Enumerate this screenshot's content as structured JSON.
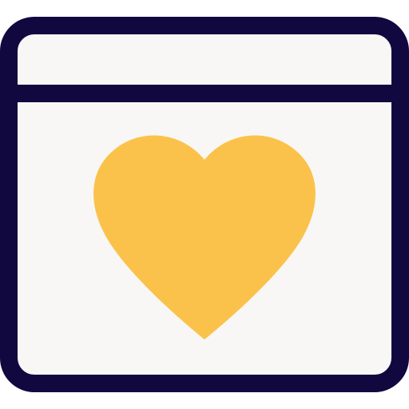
{
  "icon": {
    "name": "browser-window-heart-icon",
    "colors": {
      "background": "#ffffff",
      "window_fill": "#f8f7f6",
      "outline": "#110840",
      "heart": "#fbc24b"
    }
  }
}
